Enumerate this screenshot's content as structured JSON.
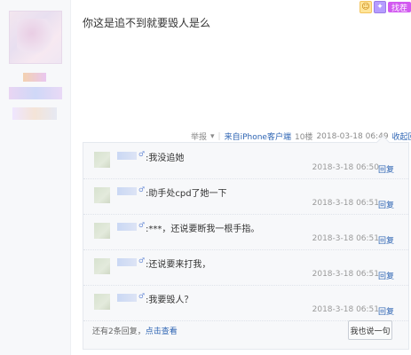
{
  "post": {
    "text": "你这是追不到就要毁人是么"
  },
  "meta": {
    "report": "举报",
    "report_arrow": "▾",
    "sep1": "|",
    "source": "来自iPhone客户端",
    "floor": "10楼",
    "datetime": "2018-03-18 06:49",
    "collapse": "收起回复"
  },
  "top_right": {
    "icon1": "☺",
    "icon2": "✦",
    "pill": "找茬"
  },
  "replies": [
    {
      "text": ":我没追她",
      "time": "2018-3-18 06:50",
      "reply": "回复"
    },
    {
      "text": ":助手处cpd了她一下",
      "time": "2018-3-18 06:51",
      "reply": "回复"
    },
    {
      "text": ":***，还说要断我一根手指。",
      "time": "2018-3-18 06:51",
      "reply": "回复"
    },
    {
      "text": ":还说要来打我，",
      "time": "2018-3-18 06:51",
      "reply": "回复"
    },
    {
      "text": ":我要毁人？",
      "time": "2018-3-18 06:51",
      "reply": "回复"
    }
  ],
  "footer": {
    "more_prefix": "还有2条回复，",
    "more_link": "点击查看",
    "say_button": "我也说一句"
  },
  "icons": {
    "gender": "male-icon"
  }
}
